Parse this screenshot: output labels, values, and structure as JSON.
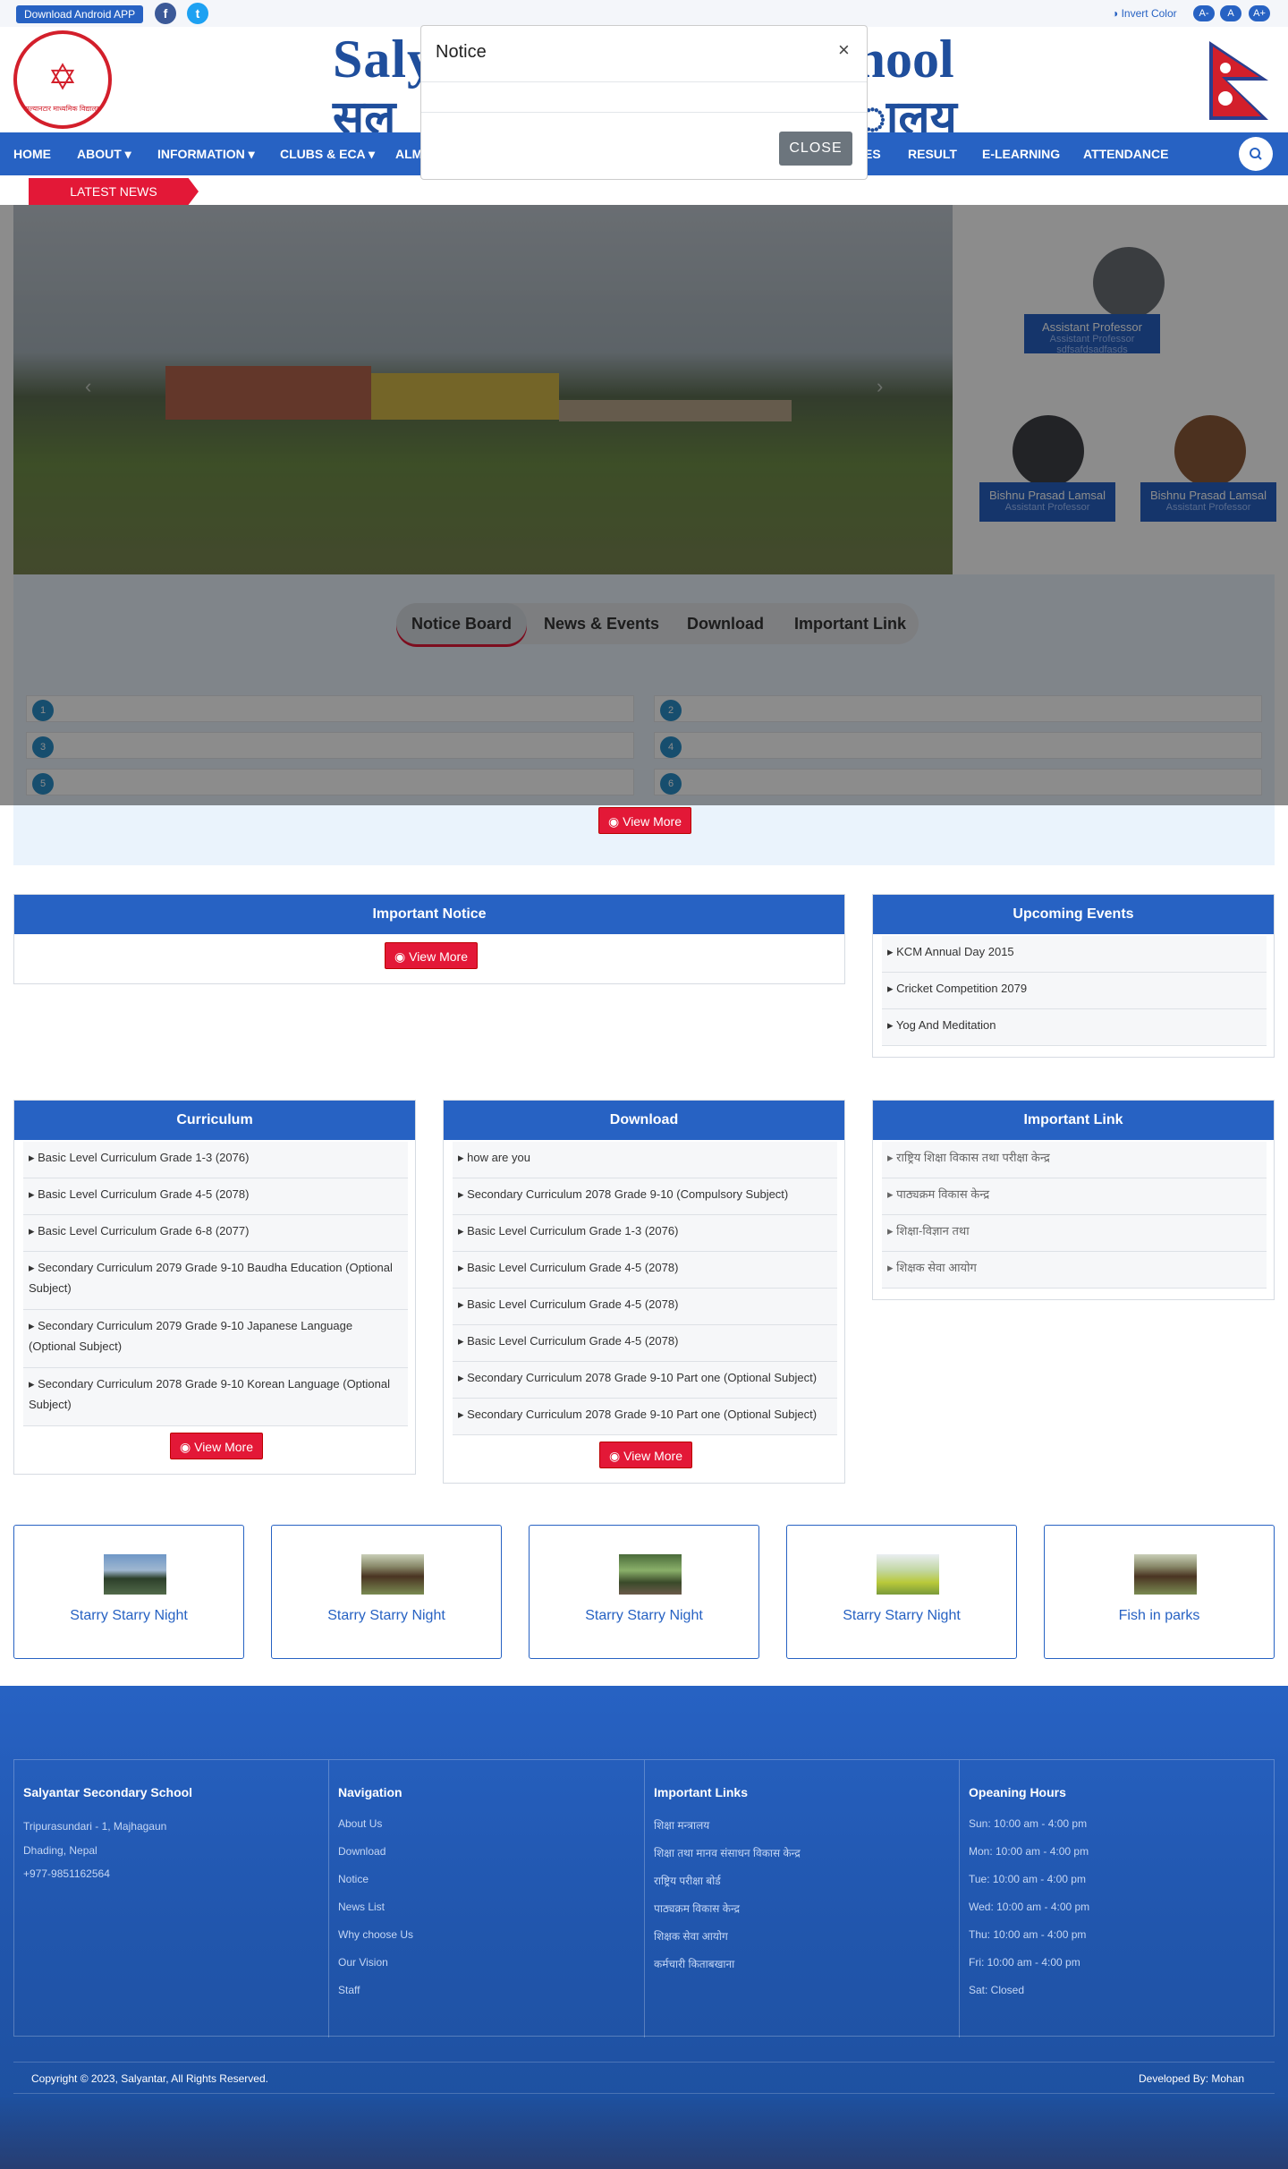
{
  "topbar": {
    "android_label": "Download Android APP",
    "facebook_icon": "f",
    "twitter_icon": "t",
    "invert_label": "Invert Color",
    "font_small": "A-",
    "font_normal": "A",
    "font_large": "A+"
  },
  "header": {
    "title_en_left": "Saly",
    "title_en_right": "chool",
    "title_np_left": "सल्",
    "title_np_right": "ालय",
    "logo_text": "सल्यानटार माध्यमिक विद्यालय"
  },
  "nav": {
    "items": [
      "HOME",
      "ABOUT",
      "INFORMATION",
      "CLUBS & ECA",
      "ALM",
      "ES",
      "RESULT",
      "E-LEARNING",
      "ATTENDANCE"
    ]
  },
  "latest_news_label": "LATEST NEWS",
  "professors": [
    {
      "name": "Assistant Professor",
      "role": "Assistant Professor sdfsafdsadfasds"
    },
    {
      "name": "Bishnu Prasad Lamsal",
      "role": "Assistant Professor"
    },
    {
      "name": "Bishnu Prasad Lamsal",
      "role": "Assistant Professor"
    }
  ],
  "tabs": [
    "Notice Board",
    "News & Events",
    "Download",
    "Important Link"
  ],
  "notice_numbers": [
    "1",
    "2",
    "3",
    "4",
    "5",
    "6"
  ],
  "view_more": "View More",
  "modal": {
    "title": "Notice",
    "close_x": "×",
    "close_button": "CLOSE"
  },
  "important_notice": {
    "title": "Important Notice"
  },
  "upcoming_events": {
    "title": "Upcoming Events",
    "items": [
      "KCM Annual Day 2015",
      "Cricket Competition 2079",
      "Yog And Meditation"
    ]
  },
  "curriculum": {
    "title": "Curriculum",
    "items": [
      "Basic Level Curriculum Grade 1-3 (2076)",
      "Basic Level Curriculum Grade 4-5 (2078)",
      "Basic Level Curriculum Grade 6-8 (2077)",
      "Secondary Curriculum 2079 Grade 9-10 Baudha Education (Optional Subject)",
      "Secondary Curriculum 2079 Grade 9-10 Japanese Language (Optional Subject)",
      "Secondary Curriculum 2078 Grade 9-10 Korean Language (Optional Subject)"
    ]
  },
  "download": {
    "title": "Download",
    "items": [
      "how are you",
      "Secondary Curriculum 2078 Grade 9-10 (Compulsory Subject)",
      "Basic Level Curriculum Grade 1-3 (2076)",
      "Basic Level Curriculum Grade 4-5 (2078)",
      "Basic Level Curriculum Grade 4-5 (2078)",
      "Basic Level Curriculum Grade 4-5 (2078)",
      "Secondary Curriculum 2078 Grade 9-10 Part one (Optional Subject)",
      "Secondary Curriculum 2078 Grade 9-10 Part one (Optional Subject)"
    ]
  },
  "important_link": {
    "title": "Important Link",
    "items": [
      "राष्ट्रिय शिक्षा विकास तथा परीक्षा केन्द्र",
      "पाठ्यक्रम विकास केन्द्र",
      "शिक्षा-विज्ञान तथा",
      "शिक्षक सेवा आयोग"
    ]
  },
  "tiles": [
    "Starry Starry Night",
    "Starry Starry Night",
    "Starry Starry Night",
    "Starry Starry Night",
    "Fish in parks"
  ],
  "footer": {
    "school": {
      "title": "Salyantar Secondary School",
      "lines": [
        "Tripurasundari - 1, Majhagaun",
        "Dhading, Nepal",
        "+977-9851162564"
      ]
    },
    "navigation": {
      "title": "Navigation",
      "items": [
        "About Us",
        "Download",
        "Notice",
        "News List",
        "Why choose Us",
        "Our Vision",
        "Staff"
      ]
    },
    "links": {
      "title": "Important Links",
      "items": [
        "शिक्षा मन्त्रालय",
        "शिक्षा तथा मानव संसाधन विकास केन्द्र",
        "राष्ट्रिय परीक्षा बोर्ड",
        "पाठ्यक्रम विकास केन्द्र",
        "शिक्षक सेवा आयोग",
        "कर्मचारी किताबखाना"
      ]
    },
    "hours": {
      "title": "Opeaning Hours",
      "items": [
        "Sun: 10:00 am - 4:00 pm",
        "Mon: 10:00 am - 4:00 pm",
        "Tue: 10:00 am - 4:00 pm",
        "Wed: 10:00 am - 4:00 pm",
        "Thu: 10:00 am - 4:00 pm",
        "Fri: 10:00 am - 4:00 pm",
        "Sat: Closed"
      ]
    },
    "copyright": "Copyright © 2023, Salyantar, All Rights Reserved.",
    "developer": "Developed By: Mohan"
  },
  "colors": {
    "primary": "#2762c3",
    "accent": "#e31837"
  }
}
